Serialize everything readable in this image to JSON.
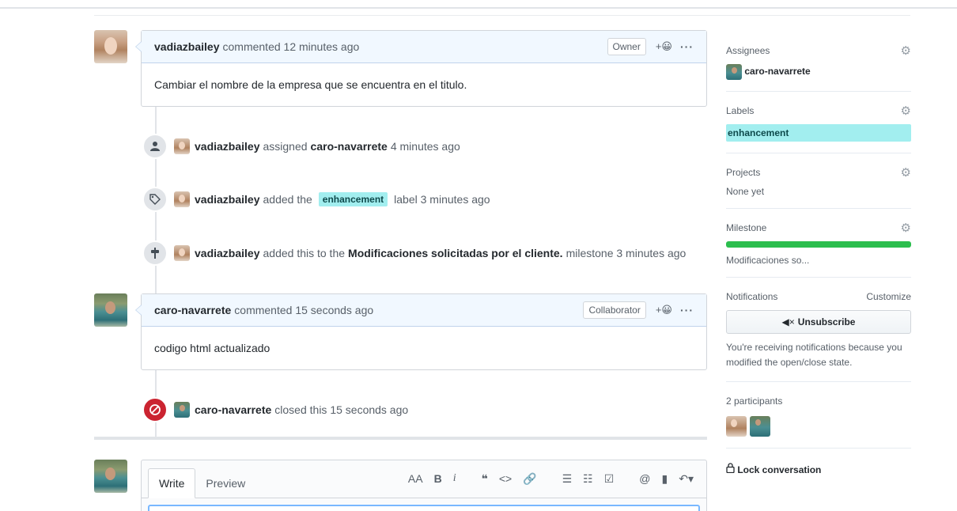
{
  "timeline": {
    "comment1": {
      "author": "vadiazbailey",
      "meta": "commented 12 minutes ago",
      "role": "Owner",
      "react": "+😀",
      "more": "···",
      "body": "Cambiar el nombre de la empresa que se encuentra en el titulo."
    },
    "event_assigned": {
      "actor": "vadiazbailey",
      "verb": "assigned",
      "target": "caro-navarrete",
      "time": "4 minutes ago"
    },
    "event_label": {
      "actor": "vadiazbailey",
      "verb": "added the",
      "label": "enhancement",
      "suffix": "label 3 minutes ago"
    },
    "event_milestone": {
      "actor": "vadiazbailey",
      "verb": "added this to the",
      "milestone": "Modificaciones solicitadas por el cliente.",
      "suffix": "milestone 3 minutes ago"
    },
    "comment2": {
      "author": "caro-navarrete",
      "meta": "commented 15 seconds ago",
      "role": "Collaborator",
      "react": "+😀",
      "more": "···",
      "body": "codigo html actualizado"
    },
    "event_closed": {
      "actor": "caro-navarrete",
      "verb": "closed this 15 seconds ago"
    }
  },
  "editor": {
    "tab_write": "Write",
    "tab_preview": "Preview",
    "toolbar": {
      "heading": "AA",
      "bold": "B",
      "italic": "i",
      "quote": "❝",
      "code": "<>",
      "link": "🔗",
      "ul": "☰",
      "ol": "☷",
      "task": "☑",
      "mention": "@",
      "bookmark": "▮",
      "reply": "↶▾"
    }
  },
  "sidebar": {
    "assignees": {
      "title": "Assignees",
      "user": "caro-navarrete"
    },
    "labels": {
      "title": "Labels",
      "label": "enhancement"
    },
    "projects": {
      "title": "Projects",
      "value": "None yet"
    },
    "milestone": {
      "title": "Milestone",
      "name": "Modificaciones so...",
      "progress": 1.0
    },
    "notifications": {
      "title": "Notifications",
      "customize": "Customize",
      "button": "Unsubscribe",
      "note": "You're receiving notifications because you modified the open/close state."
    },
    "participants": {
      "title": "2 participants"
    },
    "lock": "Lock conversation"
  },
  "colors": {
    "label_bg": "#a2eeef",
    "progress": "#2cbe4e",
    "closed": "#cb2431",
    "header_bg": "#f1f8ff"
  },
  "icons": {
    "gear": "⚙",
    "person": "👤",
    "tag": "⌂",
    "milestone": "†",
    "closed": "⊘",
    "mute": "◀×",
    "lock": "🔒"
  }
}
